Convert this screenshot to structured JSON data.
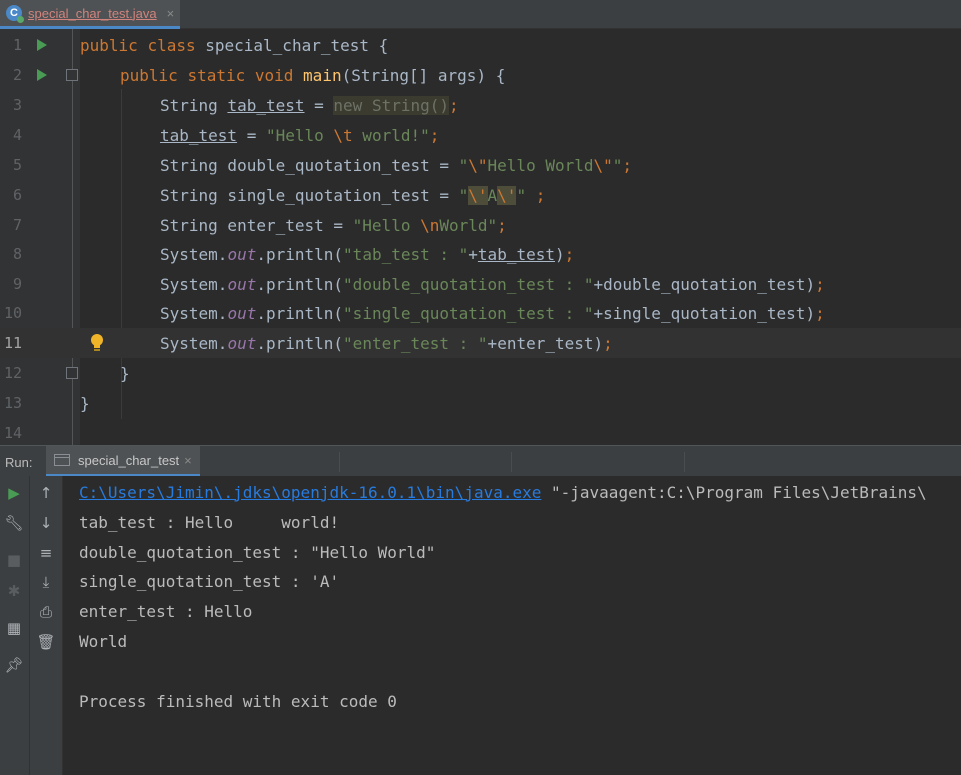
{
  "editor_tab": {
    "filename": "special_char_test.java",
    "icon": "java-class-icon",
    "close": "×"
  },
  "editor": {
    "line_numbers": [
      "1",
      "2",
      "3",
      "4",
      "5",
      "6",
      "7",
      "8",
      "9",
      "10",
      "11",
      "12",
      "13",
      "14"
    ],
    "lines": {
      "l1": {
        "kw1": "public",
        "kw2": "class",
        "name": " special_char_test {"
      },
      "l2": {
        "kw1": "public",
        "kw2": "static",
        "kw3": "void",
        "fn": "main",
        "rest": "(String[] args) {"
      },
      "l3": {
        "type": "String ",
        "var": "tab_test",
        "eq": " = ",
        "kw": "new",
        "ctor": " String()",
        "semi": ";"
      },
      "l4": {
        "var": "tab_test",
        "eq": " = ",
        "s1": "\"Hello ",
        "esc": "\\t",
        "s2": " world!\"",
        "semi": ";"
      },
      "l5": {
        "decl": "String double_quotation_test = ",
        "s1": "\"",
        "e1": "\\\"",
        "s2": "Hello World",
        "e2": "\\\"",
        "s3": "\"",
        "semi": ";"
      },
      "l6": {
        "decl": "String single_quotation_test = ",
        "s1": "\"",
        "e1": "\\'",
        "s2": "A",
        "e2": "\\'",
        "s3": "\" ",
        "semi": ";"
      },
      "l7": {
        "decl": "String enter_test = ",
        "s1": "\"Hello ",
        "esc": "\\n",
        "s2": "World\"",
        "semi": ";"
      },
      "l8": {
        "sys": "System.",
        "out": "out",
        "call": ".println(",
        "str": "\"tab_test : \"",
        "plus": "+",
        "arg": "tab_test",
        "end": ")",
        "semi": ";"
      },
      "l9": {
        "sys": "System.",
        "out": "out",
        "call": ".println(",
        "str": "\"double_quotation_test : \"",
        "plus": "+",
        "arg": "double_quotation_test",
        "end": ")",
        "semi": ";"
      },
      "l10": {
        "sys": "System.",
        "out": "out",
        "call": ".println(",
        "str": "\"single_quotation_test : \"",
        "plus": "+",
        "arg": "single_quotation_test",
        "end": ")",
        "semi": ";"
      },
      "l11": {
        "sys": "System.",
        "out": "out",
        "call": ".println(",
        "str": "\"enter_test : \"",
        "plus": "+",
        "arg": "enter_test",
        "end": ")",
        "semi": ";"
      },
      "l12": {
        "text": "}"
      },
      "l13": {
        "text": "}"
      }
    },
    "current_line": "11"
  },
  "run": {
    "label": "Run:",
    "tab": "special_char_test",
    "tab_close": "×",
    "console": {
      "cmd_link": "C:\\Users\\Jimin\\.jdks\\openjdk-16.0.1\\bin\\java.exe",
      "cmd_rest": " \"-javaagent:C:\\Program Files\\JetBrains\\",
      "out1": "tab_test : Hello     world!",
      "out2": "double_quotation_test : \"Hello World\"",
      "out3": "single_quotation_test : 'A'",
      "out4": "enter_test : Hello",
      "out5": "World",
      "out6": "Process finished with exit code 0"
    }
  },
  "colors": {
    "keyword": "#cc7832",
    "string": "#6a8759",
    "function": "#ffc66d",
    "static_field": "#9876aa",
    "text": "#a9b7c6",
    "run_green": "#499c54",
    "link": "#287bde"
  }
}
